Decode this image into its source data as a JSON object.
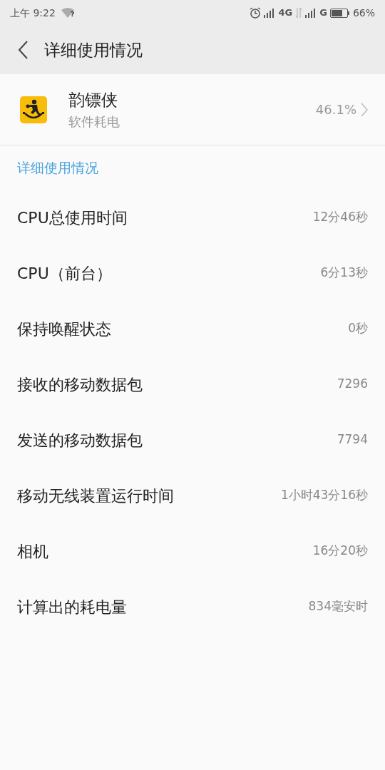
{
  "status_bar": {
    "time": "上午 9:22",
    "wifi_badge": "?",
    "network_1": "4G",
    "network_2": "G",
    "battery": "66%"
  },
  "header": {
    "title": "详细使用情况"
  },
  "app": {
    "name": "韵镖侠",
    "subtitle": "软件耗电",
    "percent": "46.1%"
  },
  "section_title": "详细使用情况",
  "rows": [
    {
      "label": "CPU总使用时间",
      "value": "12分46秒"
    },
    {
      "label": "CPU（前台）",
      "value": "6分13秒"
    },
    {
      "label": "保持唤醒状态",
      "value": "0秒"
    },
    {
      "label": "接收的移动数据包",
      "value": "7296"
    },
    {
      "label": "发送的移动数据包",
      "value": "7794"
    },
    {
      "label": "移动无线装置运行时间",
      "value": "1小时43分16秒"
    },
    {
      "label": "相机",
      "value": "16分20秒"
    },
    {
      "label": "计算出的耗电量",
      "value": "834毫安时"
    }
  ]
}
